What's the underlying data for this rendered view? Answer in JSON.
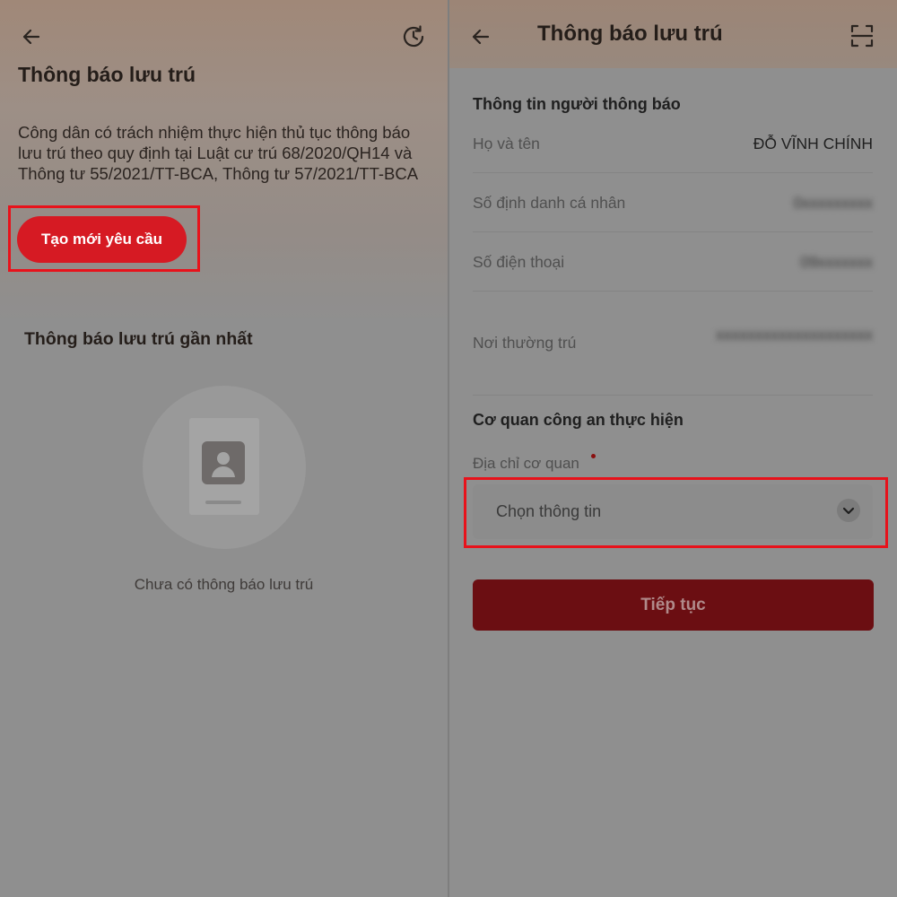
{
  "left": {
    "title": "Thông báo lưu trú",
    "description": "Công dân có trách nhiệm thực hiện thủ tục thông báo lưu trú theo quy định tại Luật cư trú 68/2020/QH14 và Thông tư 55/2021/TT-BCA, Thông tư 57/2021/TT-BCA",
    "create_button": "Tạo mới yêu cầu",
    "recent_title": "Thông báo lưu trú gần nhất",
    "empty_text": "Chưa có thông báo lưu trú",
    "icons": {
      "back": "back-arrow-icon",
      "history": "history-icon"
    }
  },
  "right": {
    "title": "Thông báo lưu trú",
    "info_section_title": "Thông tin người thông báo",
    "rows": [
      {
        "label": "Họ và tên",
        "value": "ĐỖ VĨNH CHÍNH"
      },
      {
        "label": "Số định danh cá nhân",
        "value": "0xxxxxxxxx"
      },
      {
        "label": "Số điện thoại",
        "value": "09xxxxxxx"
      },
      {
        "label": "Nơi thường trú",
        "value": "xxxxxxxxxxxxxxxxxxxx"
      }
    ],
    "police_section_title": "Cơ quan công an thực hiện",
    "address_label": "Địa chỉ cơ quan",
    "select_placeholder": "Chọn thông tin",
    "continue_button": "Tiếp tục",
    "icons": {
      "back": "back-arrow-icon",
      "scan": "scan-icon",
      "dropdown": "chevron-down-icon"
    }
  },
  "colors": {
    "accent": "#d61a23",
    "highlight": "#e8121b",
    "continue": "#6b0e12"
  }
}
